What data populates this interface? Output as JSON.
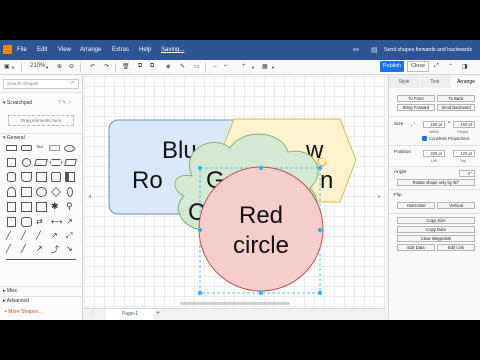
{
  "menubar": {
    "items": [
      "File",
      "Edit",
      "View",
      "Arrange",
      "Extras",
      "Help"
    ],
    "status": "Saving...",
    "tooltip": "Send shapes forwards and backwards"
  },
  "toolbar": {
    "zoom": "210%",
    "publish_label": "Publish",
    "close_label": "Close"
  },
  "sidebar": {
    "search_placeholder": "Search Shapes",
    "scratchpad_label": "Scratchpad",
    "drag_hint": "Drag elements here",
    "general_label": "General",
    "misc_label": "Misc",
    "advanced_label": "Advanced",
    "more_shapes": "+ More Shapes..."
  },
  "diagram": {
    "blue_lines": [
      "Blu",
      "Ro"
    ],
    "green_lines": [
      "G",
      "C"
    ],
    "yellow_lines": [
      "w",
      "n"
    ],
    "red_lines": [
      "Red",
      "circle"
    ]
  },
  "pages": {
    "active": "Page-1"
  },
  "panel": {
    "tabs": [
      "Style",
      "Text",
      "Arrange"
    ],
    "to_front": "To Front",
    "to_back": "To Back",
    "bring_forward": "Bring Forward",
    "send_backward": "Send Backward",
    "size_label": "Size",
    "width": "150 pt",
    "height": "150 pt",
    "width_label": "Width",
    "height_label": "Height",
    "constrain": "Constrain Proportions",
    "position_label": "Position",
    "left": "206 pt",
    "top": "120 pt",
    "left_label": "Left",
    "top_label": "Top",
    "angle_label": "Angle",
    "angle": "0°",
    "rotate": "Rotate shape only by 90°",
    "flip_label": "Flip",
    "horizontal": "Horizontal",
    "vertical": "Vertical",
    "copy_size": "Copy Size",
    "copy_data": "Copy Data",
    "clear_waypoints": "Clear Waypoints",
    "edit_data": "Edit Data",
    "edit_link": "Edit Link"
  }
}
